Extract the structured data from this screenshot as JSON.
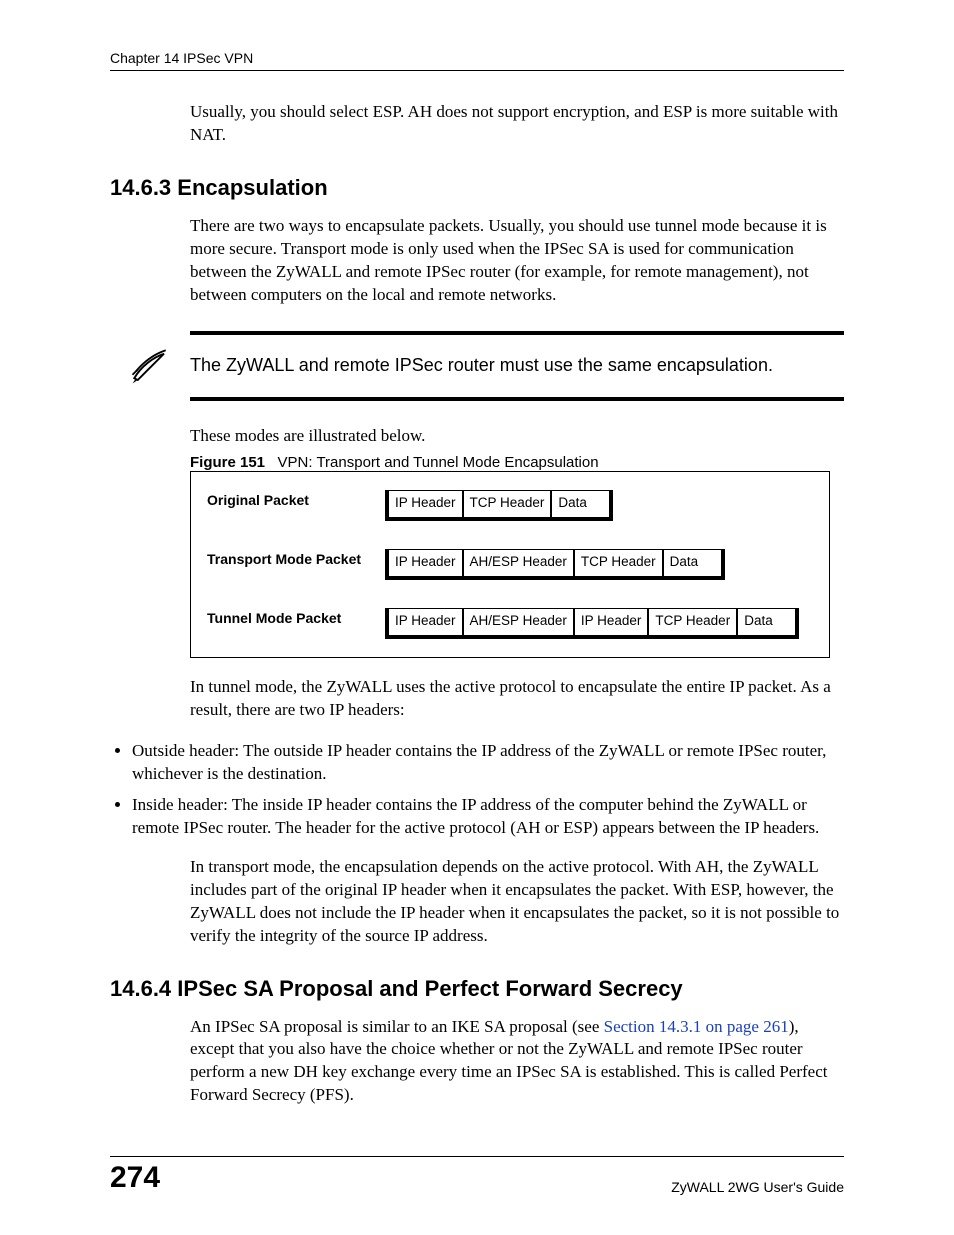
{
  "header": {
    "running_head": "Chapter 14 IPSec VPN"
  },
  "intro_para": "Usually, you should select ESP. AH does not support encryption, and ESP is more suitable with NAT.",
  "section_1463": {
    "heading": "14.6.3  Encapsulation",
    "para1": "There are two ways to encapsulate packets. Usually, you should use tunnel mode because it is more secure. Transport mode is only used when the IPSec SA is used for communication between the ZyWALL and remote IPSec router (for example, for remote management), not between computers on the local and remote networks.",
    "note": "The ZyWALL and remote IPSec router must use the same encapsulation.",
    "para2": "These modes are illustrated below.",
    "figure": {
      "label": "Figure 151",
      "caption": "VPN: Transport and Tunnel Mode Encapsulation",
      "rows": [
        {
          "label": "Original Packet",
          "cells": [
            "IP Header",
            "TCP Header",
            "Data"
          ]
        },
        {
          "label": "Transport Mode Packet",
          "cells": [
            "IP Header",
            "AH/ESP Header",
            "TCP Header",
            "Data"
          ]
        },
        {
          "label": "Tunnel Mode Packet",
          "cells": [
            "IP Header",
            "AH/ESP Header",
            "IP Header",
            "TCP Header",
            "Data"
          ]
        }
      ]
    },
    "para3": "In tunnel mode, the ZyWALL uses the active protocol to encapsulate the entire IP packet. As a result, there are two IP headers:",
    "bullets": [
      "Outside header: The outside IP header contains the IP address of the ZyWALL or remote IPSec router, whichever is the destination.",
      "Inside header: The inside IP header contains the IP address of the computer behind the ZyWALL or remote IPSec router. The header for the active protocol (AH or ESP) appears between the IP headers."
    ],
    "para4": "In transport mode, the encapsulation depends on the active protocol. With AH, the ZyWALL includes part of the original IP header when it encapsulates the packet. With ESP, however, the ZyWALL does not include the IP header when it encapsulates the packet, so it is not possible to verify the integrity of the source IP address."
  },
  "section_1464": {
    "heading": "14.6.4  IPSec SA Proposal and Perfect Forward Secrecy",
    "para_pre": "An IPSec SA proposal is similar to an IKE SA proposal (see ",
    "xref": "Section 14.3.1 on page 261",
    "para_post": "), except that you also have the choice whether or not the ZyWALL and remote IPSec router perform a new DH key exchange every time an IPSec SA is established. This is called Perfect Forward Secrecy (PFS)."
  },
  "footer": {
    "page_number": "274",
    "guide": "ZyWALL 2WG User's Guide"
  }
}
